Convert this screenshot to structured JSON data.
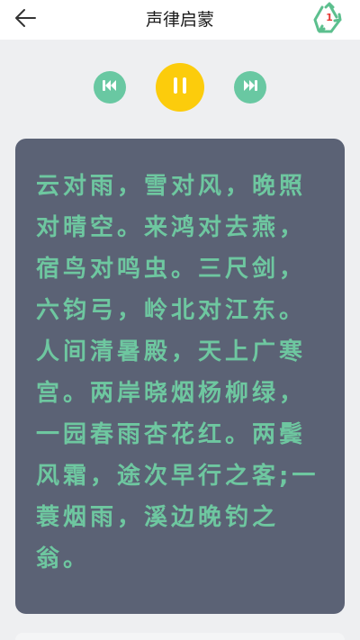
{
  "header": {
    "title": "声律启蒙",
    "back_icon": "back-arrow-icon",
    "action_icon": "recycle-icon",
    "action_badge": "1"
  },
  "player": {
    "prev_icon": "skip-previous-icon",
    "play_icon": "pause-icon",
    "next_icon": "skip-next-icon",
    "prev_color": "#69c8a2",
    "play_color": "#fccc0c",
    "next_color": "#69c8a2"
  },
  "content": {
    "text": "云对雨，雪对风，晚照对晴空。来鸿对去燕，宿鸟对鸣虫。三尺剑，六钧弓，岭北对江东。人间清暑殿，天上广寒宫。两岸晓烟杨柳绿，一园春雨杏花红。两鬓风霜，途次早行之客;一蓑烟雨，溪边晚钓之翁。",
    "card_color": "#5b6275",
    "text_color": "#6ec7a0"
  }
}
